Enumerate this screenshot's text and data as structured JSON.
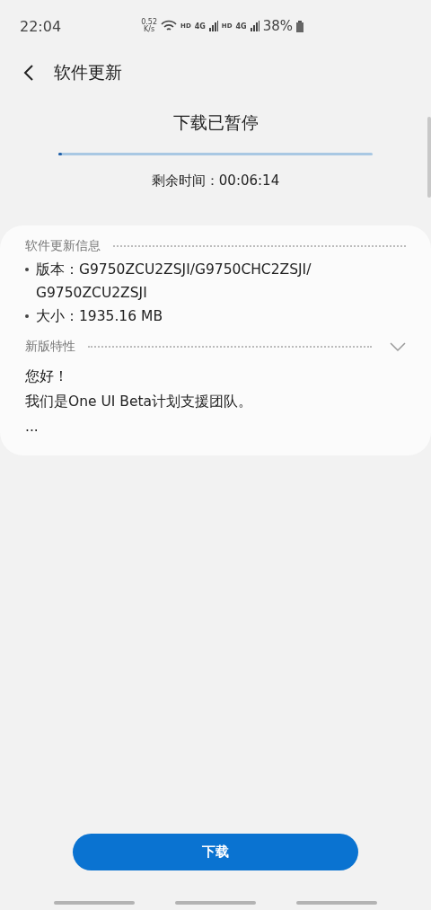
{
  "status_bar": {
    "time": "22:04",
    "speed": "0.52",
    "speed_unit": "K/s",
    "hd_1": "HD",
    "network_1": "4G",
    "hd_2": "HD",
    "network_2": "4G",
    "battery": "38%"
  },
  "header": {
    "title": "软件更新"
  },
  "download": {
    "status": "下载已暂停",
    "level": 0.01,
    "remaining": "剩余时间：00:06:14"
  },
  "info": {
    "heading": "软件更新信息",
    "items": [
      "版本：G9750ZCU2ZSJI/G9750CHC2ZSJI/ G9750ZCU2ZSJI",
      "大小：1935.16 MB"
    ]
  },
  "features": {
    "heading": "新版特性",
    "expanded": false,
    "lines": [
      "您好！",
      "我们是One UI Beta计划支援团队。",
      "..."
    ]
  },
  "button": "下载"
}
